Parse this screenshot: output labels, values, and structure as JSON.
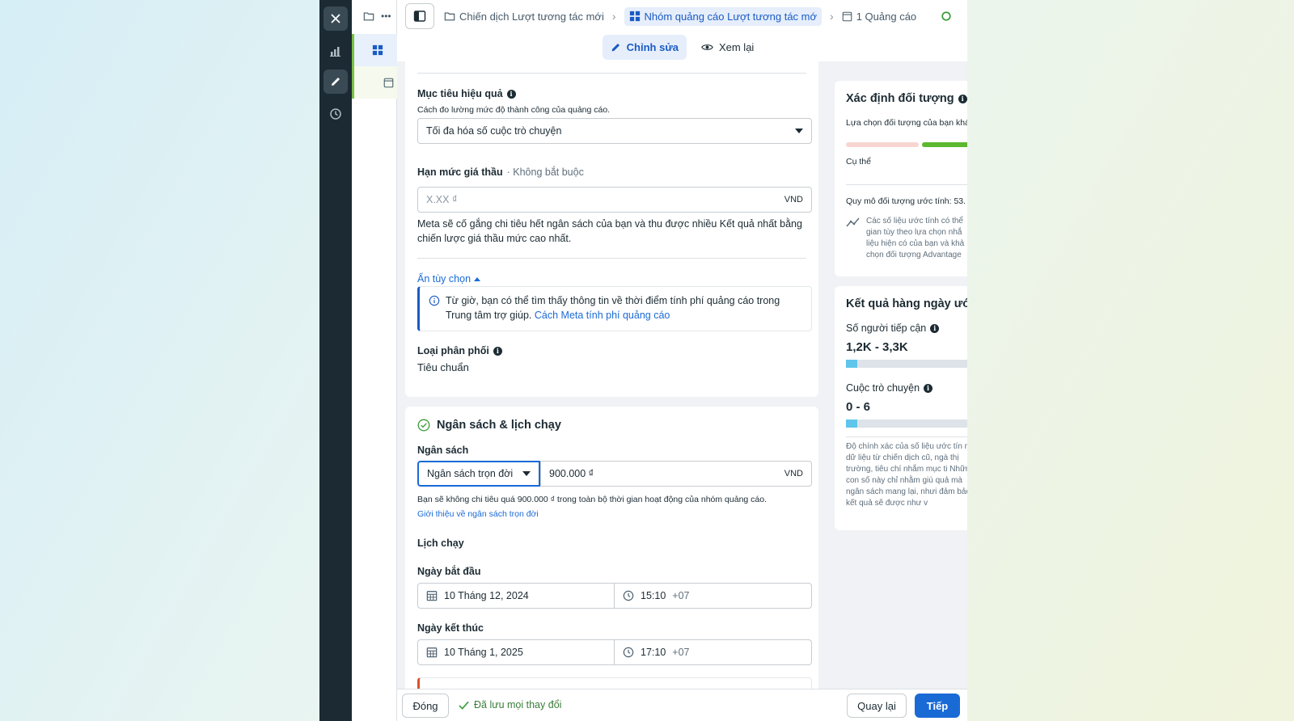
{
  "breadcrumb": {
    "campaign": "Chiến dịch Lượt tương tác mới",
    "adset": "Nhóm quảng cáo Lượt tương tác mớ",
    "ad": "1 Quảng cáo"
  },
  "modes": {
    "edit": "Chỉnh sửa",
    "review": "Xem lại"
  },
  "performance_goal": {
    "label": "Mục tiêu hiệu quả",
    "help": "Cách đo lường mức độ thành công của quảng cáo.",
    "value": "Tối đa hóa số cuộc trò chuyện"
  },
  "bid_cap": {
    "label": "Hạn mức giá thầu",
    "optional": "· Không bắt buộc",
    "placeholder": "X.XX ₫",
    "currency": "VND",
    "description": "Meta sẽ cố gắng chi tiêu hết ngân sách của bạn và thu được nhiều Kết quả nhất bằng chiến lược giá thầu mức cao nhất."
  },
  "hide_options": "Ẩn tùy chọn",
  "notice": {
    "text": "Từ giờ, bạn có thể tìm thấy thông tin về thời điểm tính phí quảng cáo trong Trung tâm trợ giúp.",
    "link": "Cách Meta tính phí quảng cáo"
  },
  "delivery": {
    "label": "Loại phân phối",
    "value": "Tiêu chuẩn"
  },
  "budget_section": {
    "title": "Ngân sách & lịch chạy",
    "budget_label": "Ngân sách",
    "budget_type": "Ngân sách trọn đời",
    "amount": "900.000 ₫",
    "currency": "VND",
    "help": "Bạn sẽ không chi tiêu quá 900.000 ₫ trong toàn bộ thời gian hoạt động của nhóm quảng cáo.",
    "help_link": "Giới thiệu về ngân sách trọn đời",
    "schedule_label": "Lịch chạy",
    "start_label": "Ngày bắt đầu",
    "start_date": "10 Tháng 12, 2024",
    "start_time": "15:10",
    "start_tz": "+07",
    "end_label": "Ngày kết thúc",
    "end_date": "10 Tháng 1, 2025",
    "end_time": "17:10",
    "end_tz": "+07"
  },
  "audience": {
    "title": "Xác định đối tượng",
    "desc": "Lựa chọn đối tượng của bạn khá",
    "specific": "Cụ thể",
    "size": "Quy mô đối tượng ước tính: 53.",
    "note": "Các số liệu ước tính có thể gian tùy theo lựa chọn nhắ liệu hiện có của bạn và khả chọn đối tượng Advantage"
  },
  "daily": {
    "title": "Kết quả hàng ngày ước",
    "reach_label": "Số người tiếp cận",
    "reach_value": "1,2K - 3,3K",
    "conv_label": "Cuộc trò chuyện",
    "conv_value": "0 - 6",
    "note": "Độ chính xác của số liệu ước tín như dữ liệu từ chiến dịch cũ, ngà thị trường, tiêu chí nhắm mục ti Những con số này chỉ nhằm giú quả mà ngân sách mang lại, nhưi đảm bảo kết quả sẽ được như v"
  },
  "footer": {
    "close": "Đóng",
    "saved": "Đã lưu mọi thay đổi",
    "back": "Quay lại",
    "next": "Tiếp"
  }
}
